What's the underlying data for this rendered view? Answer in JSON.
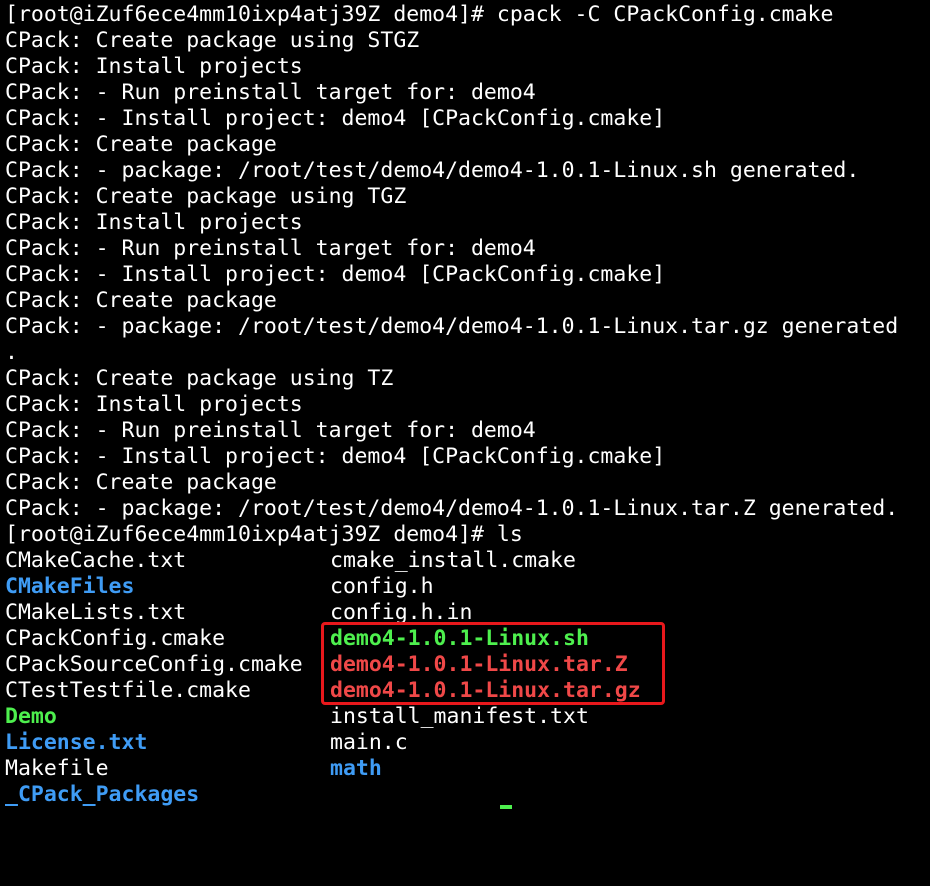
{
  "terminal": {
    "lines": [
      "[root@iZuf6ece4mm10ixp4atj39Z demo4]# cpack -C CPackConfig.cmake",
      "CPack: Create package using STGZ",
      "CPack: Install projects",
      "CPack: - Run preinstall target for: demo4",
      "CPack: - Install project: demo4 [CPackConfig.cmake]",
      "CPack: Create package",
      "CPack: - package: /root/test/demo4/demo4-1.0.1-Linux.sh generated.",
      "CPack: Create package using TGZ",
      "CPack: Install projects",
      "CPack: - Run preinstall target for: demo4",
      "CPack: - Install project: demo4 [CPackConfig.cmake]",
      "CPack: Create package",
      "CPack: - package: /root/test/demo4/demo4-1.0.1-Linux.tar.gz generated",
      ".",
      "CPack: Create package using TZ",
      "CPack: Install projects",
      "CPack: - Run preinstall target for: demo4",
      "CPack: - Install project: demo4 [CPackConfig.cmake]",
      "CPack: Create package",
      "CPack: - package: /root/test/demo4/demo4-1.0.1-Linux.tar.Z generated.",
      "[root@iZuf6ece4mm10ixp4atj39Z demo4]# ls"
    ],
    "ls_rows": [
      {
        "col1": "CMakeCache.txt",
        "col1_type": "file",
        "col2": "cmake_install.cmake",
        "col2_type": "file"
      },
      {
        "col1": "CMakeFiles",
        "col1_type": "dir",
        "col2": "config.h",
        "col2_type": "file"
      },
      {
        "col1": "CMakeLists.txt",
        "col1_type": "file",
        "col2": "config.h.in",
        "col2_type": "file"
      },
      {
        "col1": "CPackConfig.cmake",
        "col1_type": "file",
        "col2": "demo4-1.0.1-Linux.sh",
        "col2_type": "exe"
      },
      {
        "col1": "CPackSourceConfig.cmake",
        "col1_type": "file",
        "col2": "demo4-1.0.1-Linux.tar.Z",
        "col2_type": "archive"
      },
      {
        "col1": "CTestTestfile.cmake",
        "col1_type": "file",
        "col2": "demo4-1.0.1-Linux.tar.gz",
        "col2_type": "archive"
      },
      {
        "col1": "Demo",
        "col1_type": "exe",
        "col2": "install_manifest.txt",
        "col2_type": "file"
      },
      {
        "col1": "License.txt",
        "col1_type": "dir",
        "col2": "main.c",
        "col2_type": "file"
      },
      {
        "col1": "Makefile",
        "col1_type": "file",
        "col2": "math",
        "col2_type": "dir"
      },
      {
        "col1": "_CPack_Packages",
        "col1_type": "dir",
        "col2": "",
        "col2_type": "file"
      }
    ]
  },
  "colors": {
    "background": "#000000",
    "text": "#ffffff",
    "directory": "#3f9cf5",
    "executable": "#4ef04e",
    "archive": "#f04848",
    "highlight_border": "#e8181c"
  }
}
